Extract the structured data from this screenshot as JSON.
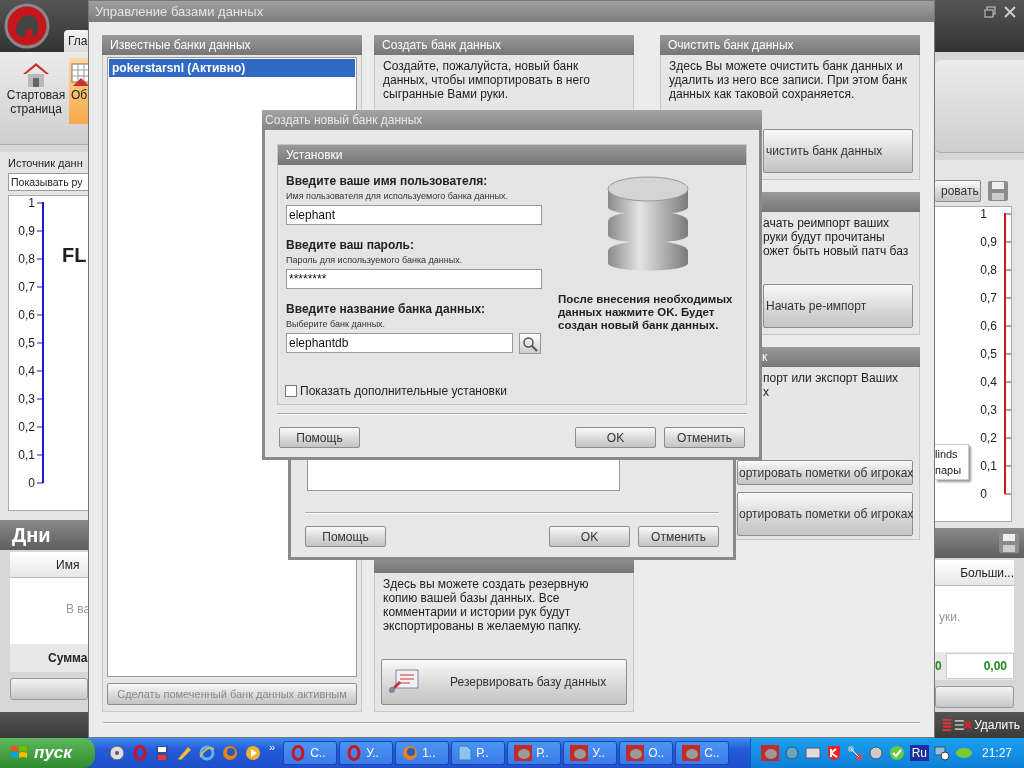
{
  "app": {
    "tab": "Гла",
    "ribbon": [
      {
        "label": "Стартовая страница",
        "selected": false
      },
      {
        "label": "Об",
        "selected": true
      }
    ],
    "source_label": "Источник данн",
    "source_dropdown": "Показывать ру",
    "chart_title": "FL",
    "left_axis": [
      "1",
      "0,9",
      "0,8",
      "0,7",
      "0,6",
      "0,5",
      "0,4",
      "0,3",
      "0,2",
      "0,1",
      "0"
    ],
    "right_button": "ровать",
    "right_axis": [
      "1",
      "0,9",
      "0,8",
      "0,7",
      "0,6",
      "0,5",
      "0,4",
      "0,3",
      "0,2",
      "0,1",
      "0"
    ],
    "legend": [
      "linds",
      "пары"
    ],
    "days_title": "Дни",
    "left_column": "Имя",
    "right_column": "Больши...",
    "empty_left": "В ва",
    "empty_right": "уки.",
    "sum_label": "Сумма",
    "sum_values": [
      "0",
      "0,00"
    ],
    "delete_button": "Удалить"
  },
  "manager": {
    "title": "Управление базами данных",
    "known": {
      "title": "Известные банки данных",
      "items": [
        {
          "label": "pokerstarsnl (Активно)",
          "selected": true
        }
      ],
      "button": {
        "label": "Сделать помеченный банк данных активным",
        "disabled": true
      }
    },
    "create": {
      "title": "Создать банк данных",
      "text": "Создайте, пожалуйста, новый банк данных, чтобы импортировать в него сыгранные Вами руки."
    },
    "backup": {
      "text": "Здесь вы можете создать резервную копию вашей базы данных. Все комментарии и истории рук будут экспортированы в желаемую папку.",
      "button": "Резервировать базу данных"
    },
    "clear": {
      "title": "Очистить банк данных",
      "text": "Здесь Вы можете очистить банк данных и удалить из него все записи. При этом банк данных как таковой сохраняется.",
      "button": "чистить банк данных"
    },
    "reimport": {
      "lines": [
        "ачать реимпорт ваших",
        "руки будут прочитаны",
        "ожет быть новый патч баз"
      ],
      "button": "Начать ре-импорт"
    },
    "export": {
      "title": "к",
      "lines": [
        "порт или экспорт Ваших",
        "х"
      ],
      "buttons": [
        "ортировать пометки об игроках",
        "ортировать пометки об игроках"
      ]
    }
  },
  "middle_dialog": {
    "buttons": {
      "help": "Помощь",
      "ok": "OK",
      "cancel": "Отменить"
    }
  },
  "dialog": {
    "title": "Создать новый банк данных",
    "group": "Установки",
    "fields": [
      {
        "kind": "text",
        "label": "Введите ваше имя пользователя:",
        "hint": "Имя пользователя для используемого банка данных.",
        "value": "elephant"
      },
      {
        "kind": "text",
        "label": "Введите ваш пароль:",
        "hint": "Пароль для используемого банка данных.",
        "value": "********"
      },
      {
        "kind": "browse",
        "label": "Введите название банка данных:",
        "hint": "Выберите банк данных.",
        "value": "elephantdb"
      }
    ],
    "note": "После внесения необходимых данных нажмите OK. Будет создан новый банк данных.",
    "checkbox": {
      "label": "Показать дополнительные установки",
      "checked": false
    },
    "buttons": {
      "help": "Помощь",
      "ok": "OK",
      "cancel": "Отменить"
    }
  },
  "taskbar": {
    "start": "пуск",
    "chevron": "»",
    "tasks": [
      {
        "label": "С.."
      },
      {
        "label": "У.."
      },
      {
        "label": "1.."
      },
      {
        "label": "Р.."
      },
      {
        "label": "Р.."
      },
      {
        "label": "У.."
      },
      {
        "label": "О.."
      },
      {
        "label": "С.."
      }
    ],
    "language": "Ru",
    "clock": "21:27"
  }
}
